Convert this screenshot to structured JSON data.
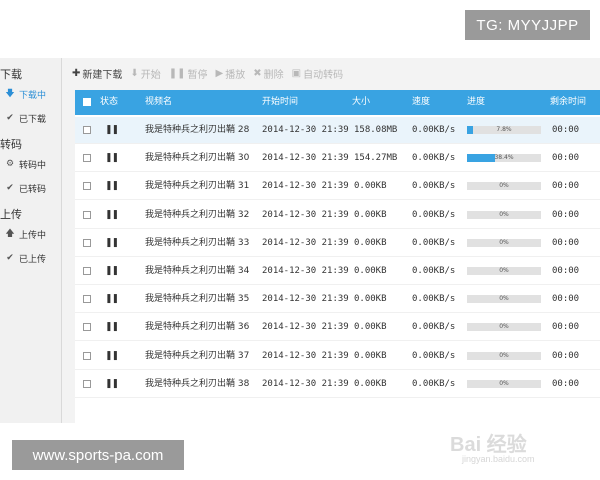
{
  "watermarks": {
    "top_badge": "TG: MYYJJPP",
    "bottom_badge": "www.sports-pa.com",
    "baidu_logo": "Bai 经验",
    "baidu_url": "jingyan.baidu.com"
  },
  "sidebar": {
    "sections": [
      {
        "title": "下载",
        "items": [
          {
            "label": "下载中",
            "icon": "download-arrow-icon",
            "active": true
          },
          {
            "label": "已下载",
            "icon": "checkmark-icon",
            "active": false
          }
        ]
      },
      {
        "title": "转码",
        "items": [
          {
            "label": "转码中",
            "icon": "gear-icon",
            "active": false
          },
          {
            "label": "已转码",
            "icon": "checkmark-icon",
            "active": false
          }
        ]
      },
      {
        "title": "上传",
        "items": [
          {
            "label": "上传中",
            "icon": "upload-arrow-icon",
            "active": false
          },
          {
            "label": "已上传",
            "icon": "checkmark-icon",
            "active": false
          }
        ]
      }
    ]
  },
  "toolbar": {
    "new_download": "新建下载",
    "start": "开始",
    "pause": "暂停",
    "play": "播放",
    "delete": "删除",
    "auto_transcode": "自动转码"
  },
  "table": {
    "headers": {
      "status": "状态",
      "name": "视频名",
      "start_time": "开始时间",
      "size": "大小",
      "speed": "速度",
      "progress": "进度",
      "remaining": "剩余时间"
    },
    "rows": [
      {
        "status": "❚❚",
        "name": "我是特种兵之利刃出鞘 28",
        "start_time": "2014-12-30 21:39",
        "size": "158.08MB",
        "speed": "0.00KB/s",
        "progress": 7.8,
        "progress_label": "7.8%",
        "remaining": "00:00",
        "highlight": true
      },
      {
        "status": "❚❚",
        "name": "我是特种兵之利刃出鞘 30",
        "start_time": "2014-12-30 21:39",
        "size": "154.27MB",
        "speed": "0.00KB/s",
        "progress": 38.4,
        "progress_label": "38.4%",
        "remaining": "00:00",
        "highlight": false
      },
      {
        "status": "❚❚",
        "name": "我是特种兵之利刃出鞘 31",
        "start_time": "2014-12-30 21:39",
        "size": "0.00KB",
        "speed": "0.00KB/s",
        "progress": 0,
        "progress_label": "0%",
        "remaining": "00:00",
        "highlight": false
      },
      {
        "status": "❚❚",
        "name": "我是特种兵之利刃出鞘 32",
        "start_time": "2014-12-30 21:39",
        "size": "0.00KB",
        "speed": "0.00KB/s",
        "progress": 0,
        "progress_label": "0%",
        "remaining": "00:00",
        "highlight": false
      },
      {
        "status": "❚❚",
        "name": "我是特种兵之利刃出鞘 33",
        "start_time": "2014-12-30 21:39",
        "size": "0.00KB",
        "speed": "0.00KB/s",
        "progress": 0,
        "progress_label": "0%",
        "remaining": "00:00",
        "highlight": false
      },
      {
        "status": "❚❚",
        "name": "我是特种兵之利刃出鞘 34",
        "start_time": "2014-12-30 21:39",
        "size": "0.00KB",
        "speed": "0.00KB/s",
        "progress": 0,
        "progress_label": "0%",
        "remaining": "00:00",
        "highlight": false
      },
      {
        "status": "❚❚",
        "name": "我是特种兵之利刃出鞘 35",
        "start_time": "2014-12-30 21:39",
        "size": "0.00KB",
        "speed": "0.00KB/s",
        "progress": 0,
        "progress_label": "0%",
        "remaining": "00:00",
        "highlight": false
      },
      {
        "status": "❚❚",
        "name": "我是特种兵之利刃出鞘 36",
        "start_time": "2014-12-30 21:39",
        "size": "0.00KB",
        "speed": "0.00KB/s",
        "progress": 0,
        "progress_label": "0%",
        "remaining": "00:00",
        "highlight": false
      },
      {
        "status": "❚❚",
        "name": "我是特种兵之利刃出鞘 37",
        "start_time": "2014-12-30 21:39",
        "size": "0.00KB",
        "speed": "0.00KB/s",
        "progress": 0,
        "progress_label": "0%",
        "remaining": "00:00",
        "highlight": false
      },
      {
        "status": "❚❚",
        "name": "我是特种兵之利刃出鞘 38",
        "start_time": "2014-12-30 21:39",
        "size": "0.00KB",
        "speed": "0.00KB/s",
        "progress": 0,
        "progress_label": "0%",
        "remaining": "00:00",
        "highlight": false
      }
    ]
  },
  "colors": {
    "header_blue": "#39a3e2",
    "accent": "#2c8fd6"
  }
}
